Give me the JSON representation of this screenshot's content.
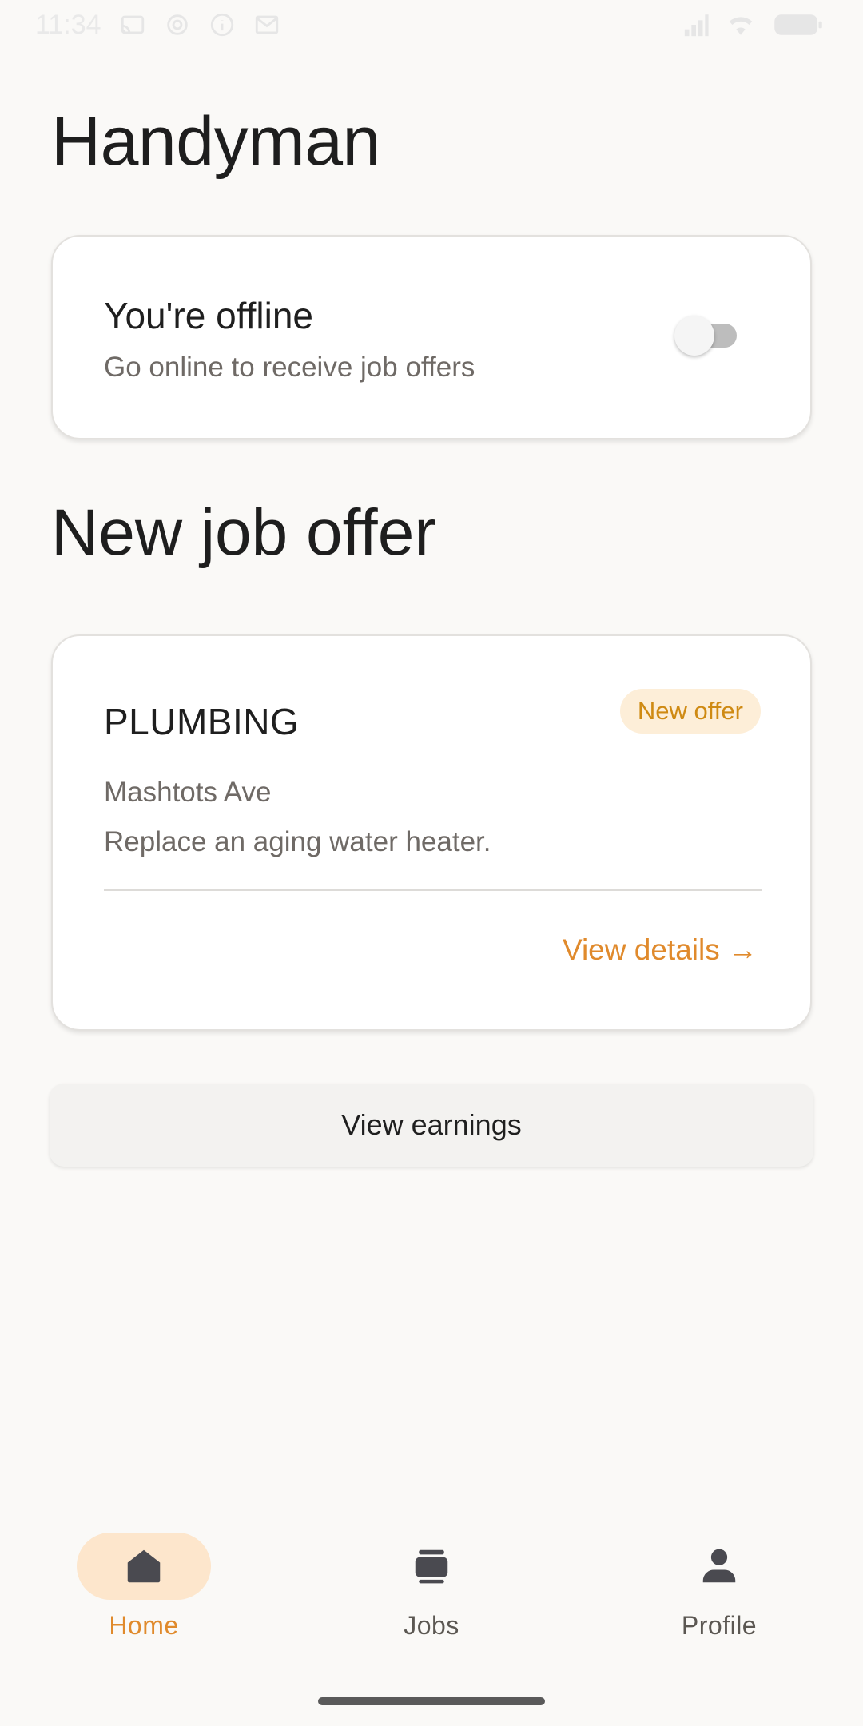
{
  "status_bar": {
    "time": "11:34",
    "left_icons": [
      "cast-icon",
      "settings-gear-icon",
      "info-icon",
      "mail-icon"
    ],
    "right_icons": [
      "signal-icon",
      "wifi-icon",
      "battery-icon"
    ]
  },
  "app": {
    "title": "Handyman"
  },
  "status_card": {
    "title": "You're offline",
    "subtitle": "Go online to receive job offers",
    "online": false
  },
  "section": {
    "title": "New job offer"
  },
  "offer": {
    "category": "PLUMBING",
    "badge": "New offer",
    "address": "Mashtots Ave",
    "description": "Replace an aging water heater.",
    "link_label": "View details →"
  },
  "earnings": {
    "label": "View earnings"
  },
  "nav": {
    "items": [
      {
        "label": "Home",
        "icon": "home-icon",
        "active": true
      },
      {
        "label": "Jobs",
        "icon": "jobs-icon",
        "active": false
      },
      {
        "label": "Profile",
        "icon": "profile-icon",
        "active": false
      }
    ]
  },
  "colors": {
    "accent": "#e08a2c",
    "badge_bg": "#fdeed8",
    "badge_text": "#cf8a13",
    "nav_active_bg": "#fde6cc",
    "background": "#faf9f7"
  }
}
